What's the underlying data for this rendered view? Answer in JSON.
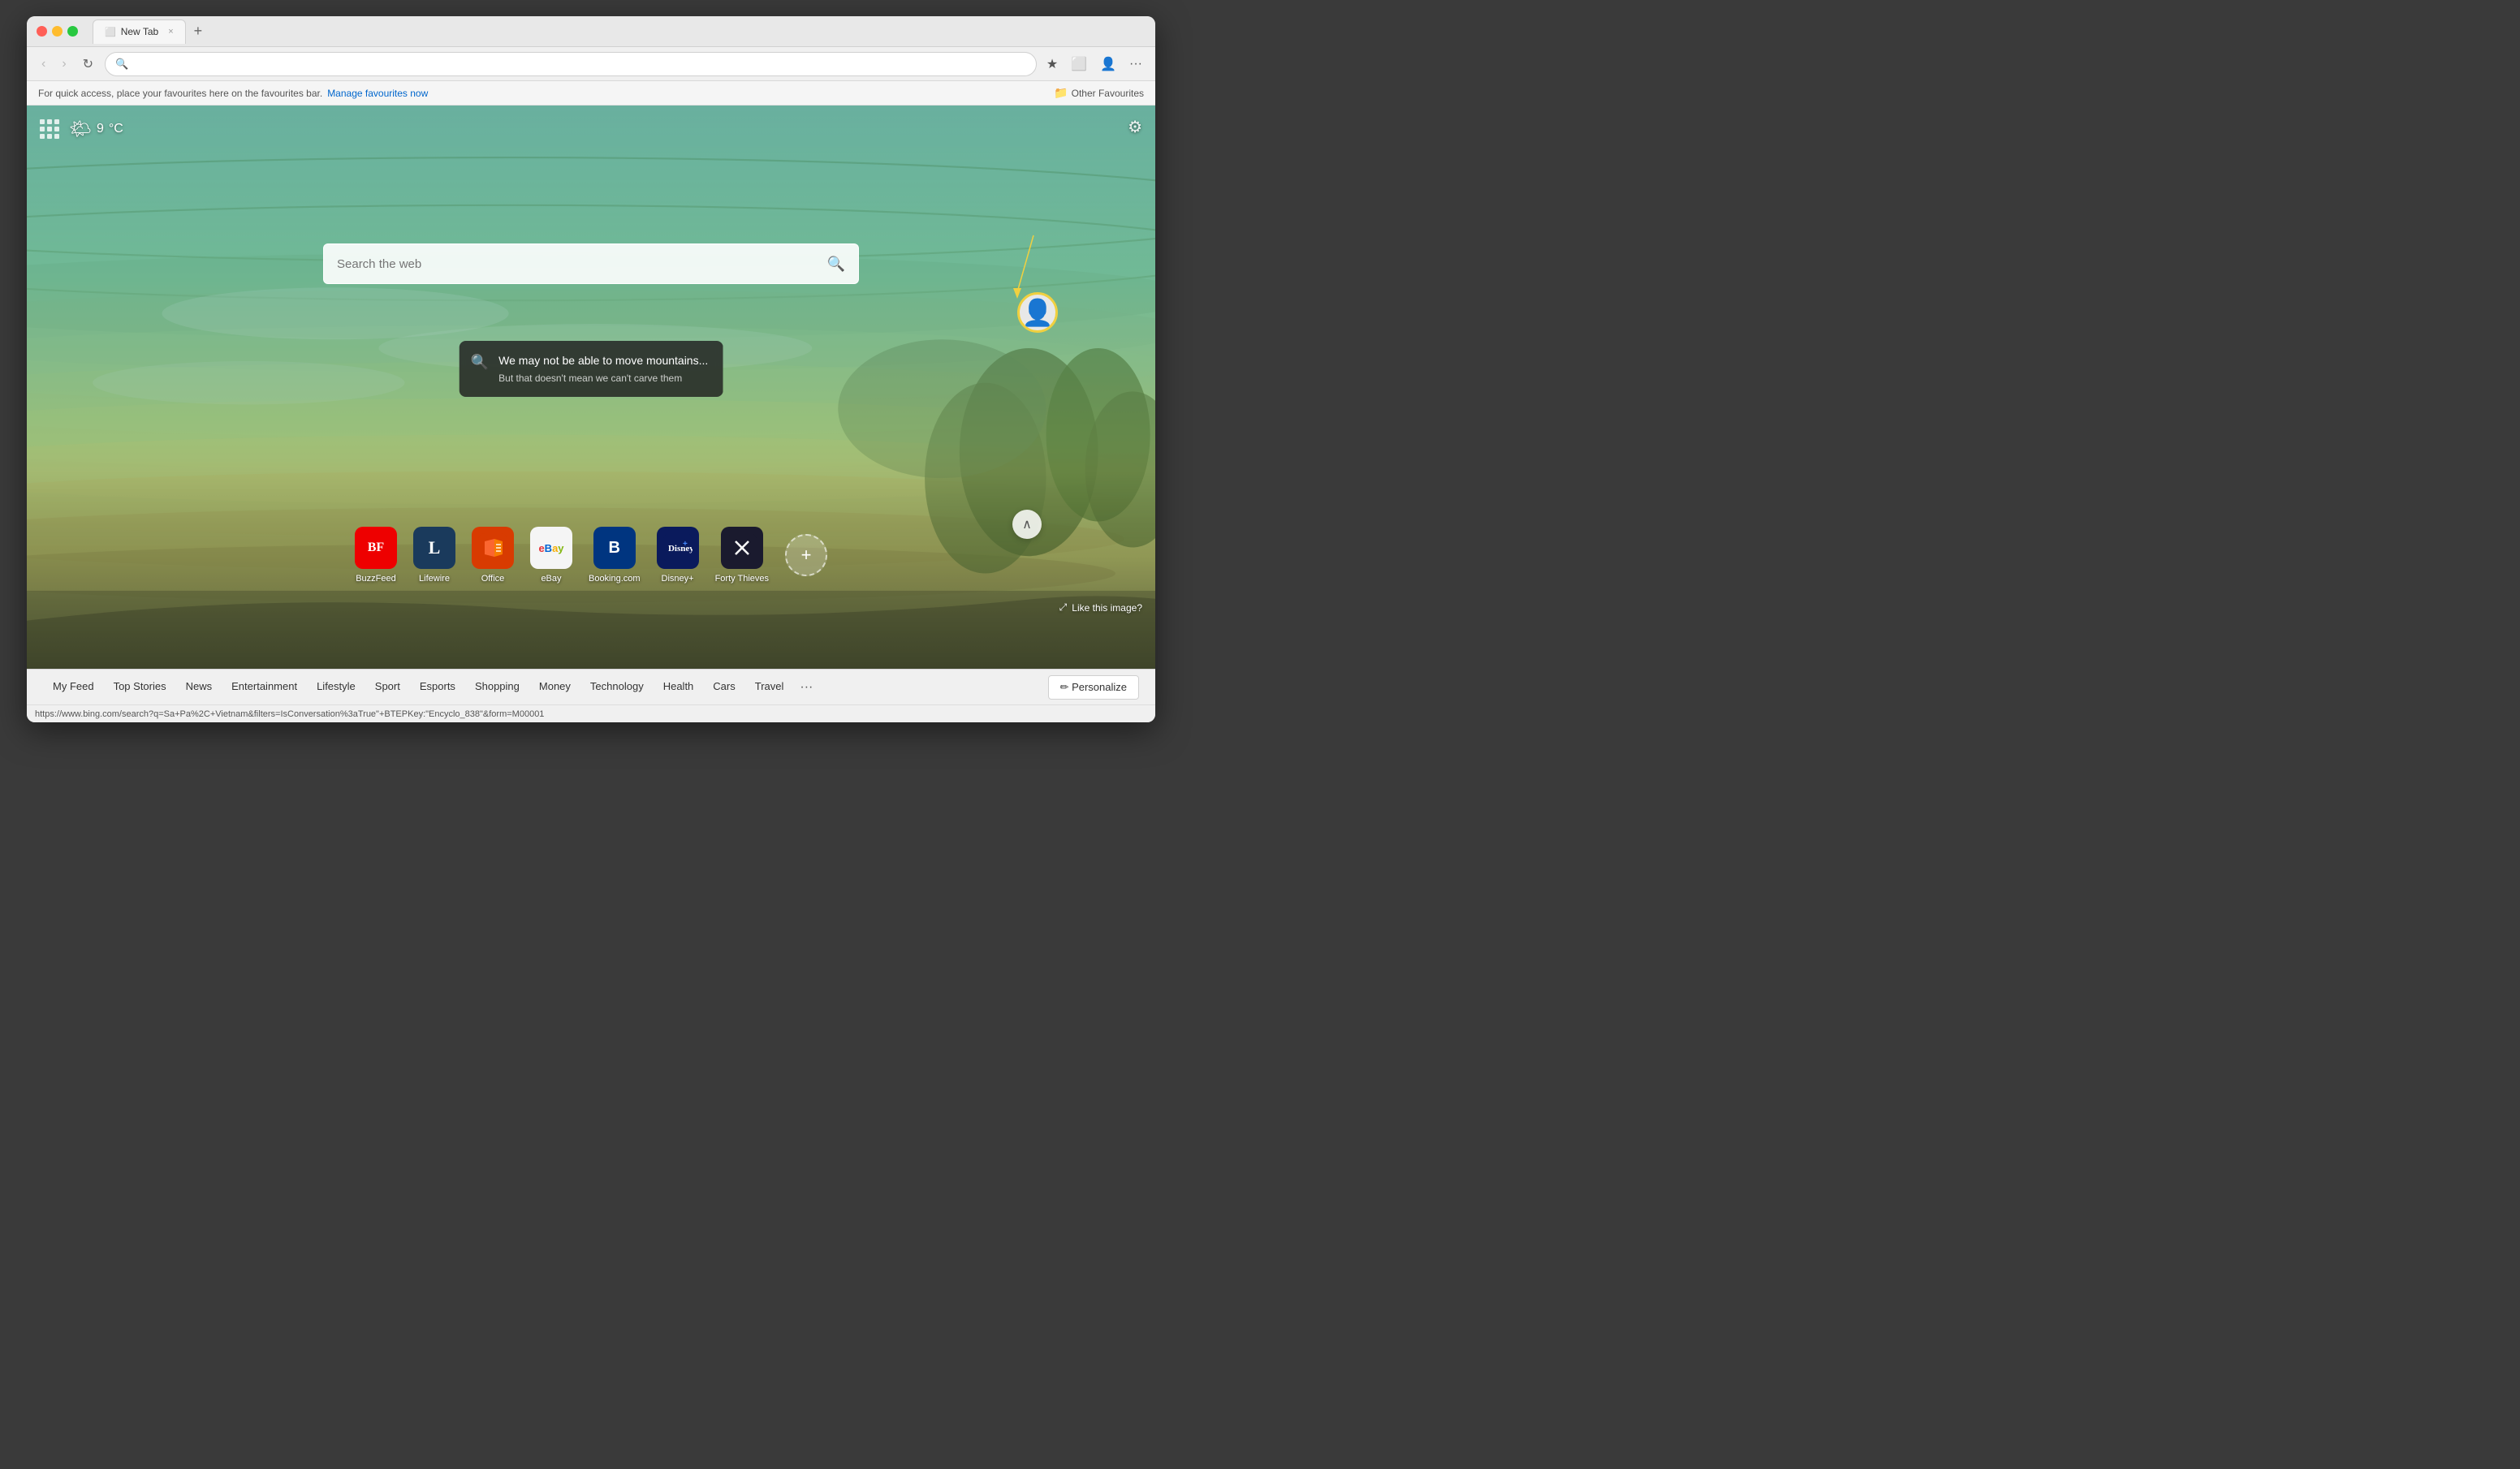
{
  "browser": {
    "tab": {
      "title": "New Tab",
      "close_label": "×",
      "new_tab_label": "+"
    },
    "nav": {
      "back_label": "‹",
      "forward_label": "›",
      "refresh_label": "↻",
      "address_placeholder": "",
      "address_value": ""
    },
    "favbar": {
      "message": "For quick access, place your favourites here on the favourites bar.",
      "manage_label": "Manage favourites now",
      "other_label": "Other Favourites"
    }
  },
  "page": {
    "weather": {
      "icon": "🌤",
      "temp": "9",
      "unit": "°C"
    },
    "search": {
      "placeholder": "Search the web"
    },
    "quote": {
      "main": "We may not be able to move mountains...",
      "sub": "But that doesn't mean we can't carve them"
    },
    "like_image_label": "Like this image?",
    "quick_links": [
      {
        "id": "buzzfeed",
        "label": "BuzzFeed",
        "icon_text": "BF",
        "bg": "#ee0000",
        "color": "white"
      },
      {
        "id": "lifewire",
        "label": "Lifewire",
        "icon_text": "L",
        "bg": "#1a3a5c",
        "color": "white"
      },
      {
        "id": "office",
        "label": "Office",
        "icon_text": "O",
        "bg": "#d83b01",
        "color": "white"
      },
      {
        "id": "ebay",
        "label": "eBay",
        "icon_text": "eBay",
        "bg": "#f5f5f5",
        "color": "#333"
      },
      {
        "id": "booking",
        "label": "Booking.com",
        "icon_text": "B",
        "bg": "#003580",
        "color": "white"
      },
      {
        "id": "disney",
        "label": "Disney+",
        "icon_text": "D+",
        "bg": "#0a1a5c",
        "color": "white"
      },
      {
        "id": "fortythieves",
        "label": "Forty Thieves",
        "icon_text": "✕",
        "bg": "#1a1a2e",
        "color": "white"
      }
    ],
    "bottom_nav": [
      {
        "id": "myfeed",
        "label": "My Feed"
      },
      {
        "id": "topstories",
        "label": "Top Stories"
      },
      {
        "id": "news",
        "label": "News"
      },
      {
        "id": "entertainment",
        "label": "Entertainment"
      },
      {
        "id": "lifestyle",
        "label": "Lifestyle"
      },
      {
        "id": "sport",
        "label": "Sport"
      },
      {
        "id": "esports",
        "label": "Esports"
      },
      {
        "id": "shopping",
        "label": "Shopping"
      },
      {
        "id": "money",
        "label": "Money"
      },
      {
        "id": "technology",
        "label": "Technology"
      },
      {
        "id": "health",
        "label": "Health"
      },
      {
        "id": "cars",
        "label": "Cars"
      },
      {
        "id": "travel",
        "label": "Travel"
      }
    ],
    "personalize_label": "✏ Personalize",
    "status_url": "https://www.bing.com/search?q=Sa+Pa%2C+Vietnam&filters=IsConversation%3aTrue\"+BTEPKey:\"Encyclo_838\"&form=M00001"
  }
}
